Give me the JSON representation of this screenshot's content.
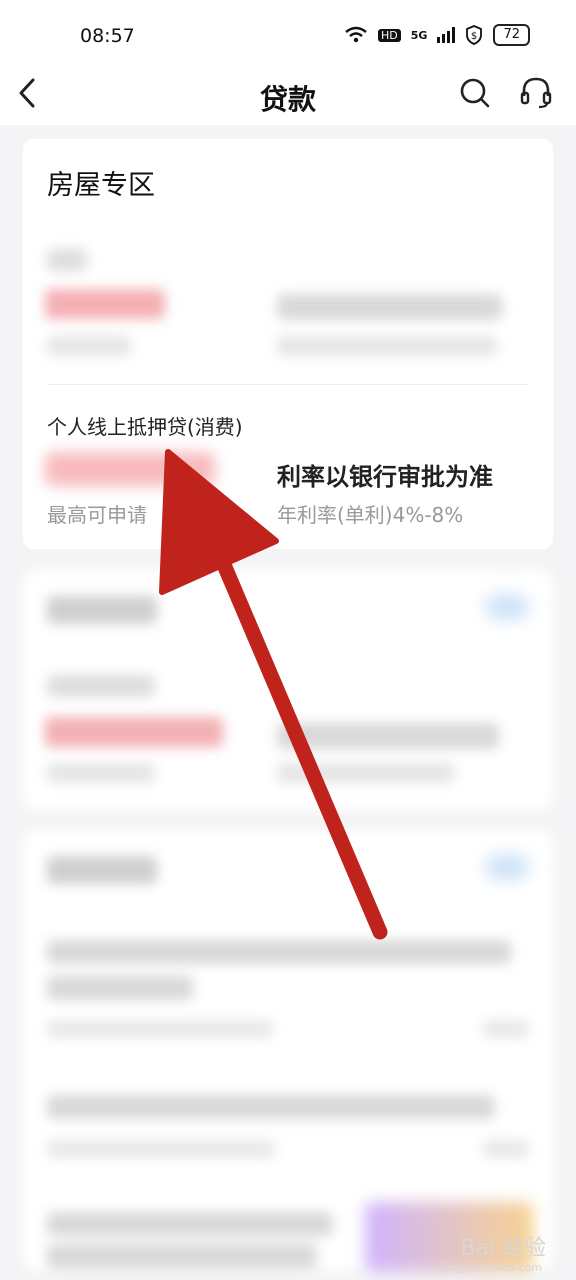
{
  "status_bar": {
    "time": "08:57",
    "network_label": "5G",
    "hd_label": "HD",
    "battery": "72"
  },
  "header": {
    "title": "贷款"
  },
  "housing_zone": {
    "title": "房屋专区",
    "product": {
      "name": "个人线上抵押贷(消费)",
      "max_label": "最高可申请",
      "rate_label": "利率以银行审批为准",
      "rate_note": "年利率(单利)4%-8%"
    }
  },
  "watermark": {
    "main": "Bai  经验",
    "sub": "jingyan.baidu.com"
  },
  "colors": {
    "amount_red": "#ef6770",
    "arrow_red": "#c0231b"
  },
  "icons": {
    "back": "back-icon",
    "search": "search-icon",
    "service": "headset-icon"
  }
}
